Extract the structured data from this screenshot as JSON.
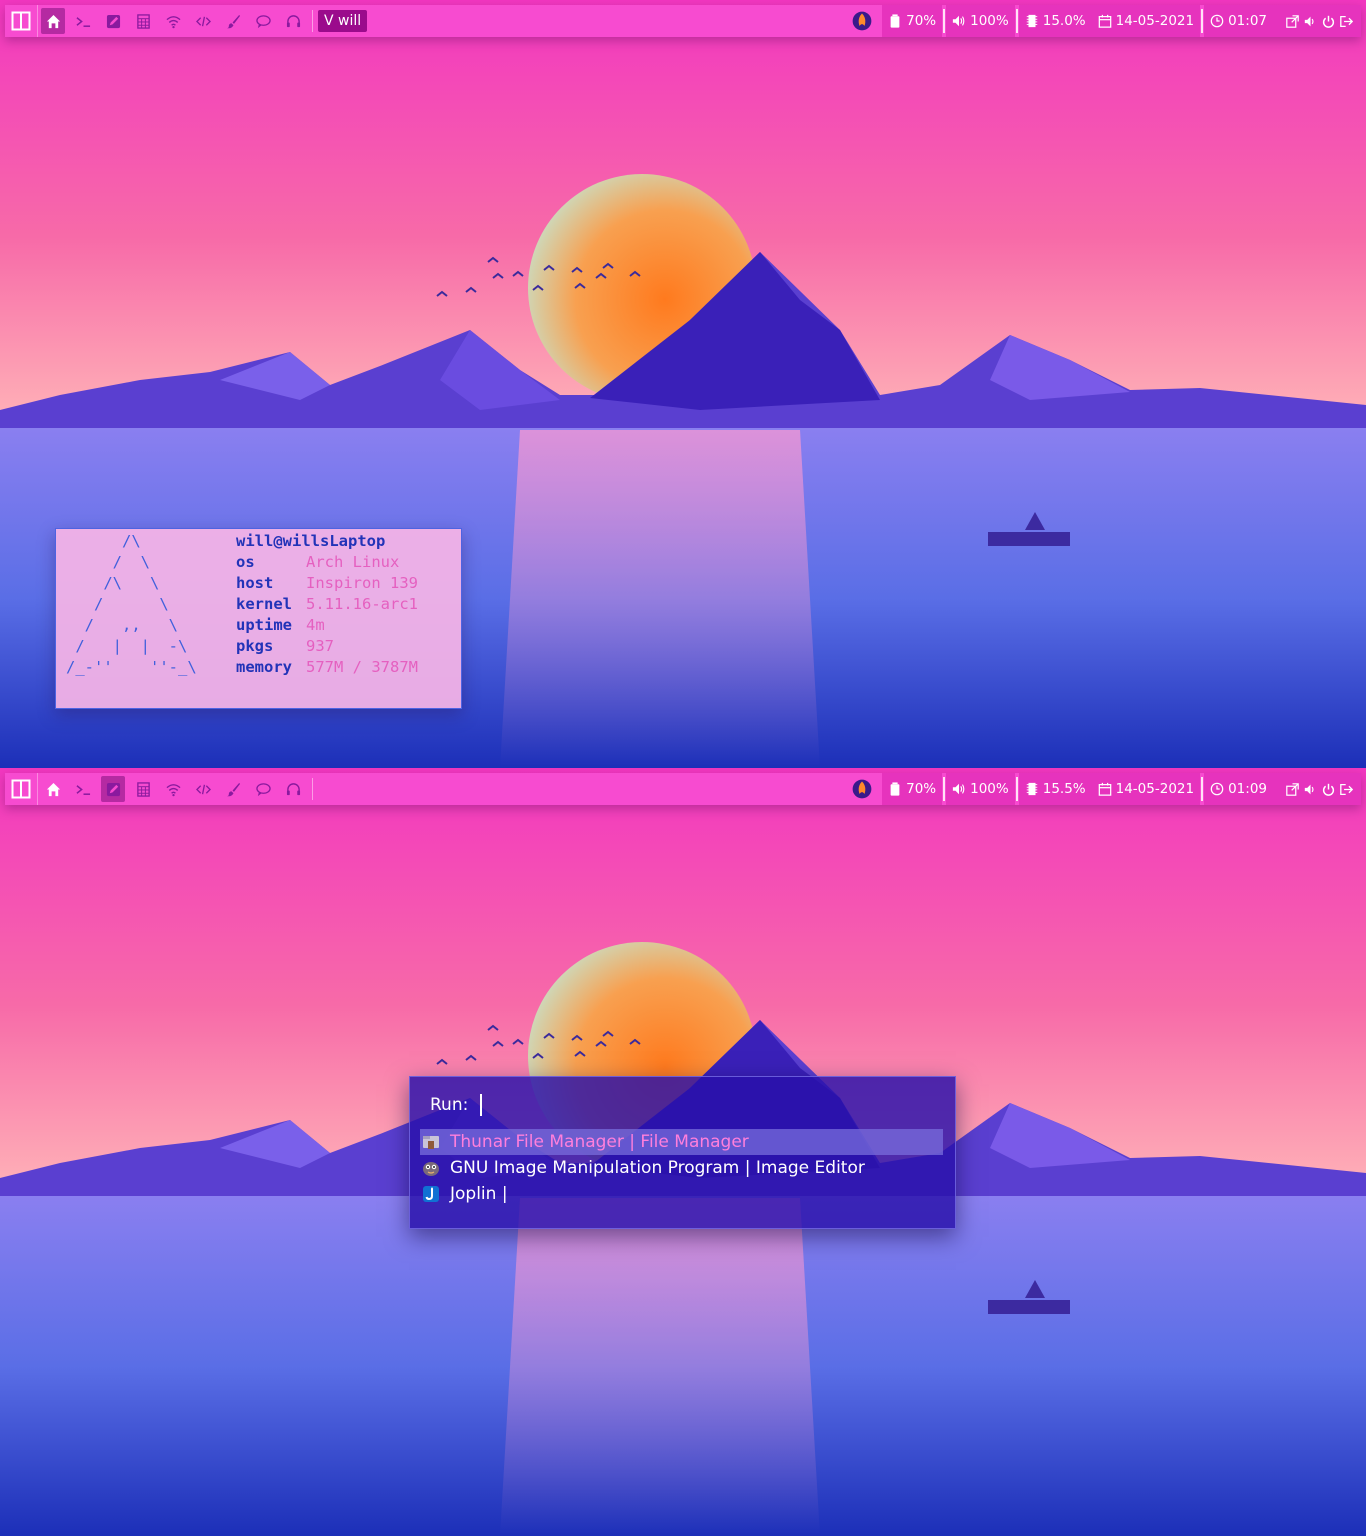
{
  "screens": {
    "top": {
      "bar": {
        "active_workspace": "home",
        "window_title": "V will",
        "battery": "70%",
        "volume": "100%",
        "cpu": "15.0%",
        "date": "14-05-2021",
        "time": "01:07"
      }
    },
    "bottom": {
      "bar": {
        "active_workspace": "edit",
        "battery": "70%",
        "volume": "100%",
        "cpu": "15.5%",
        "date": "14-05-2021",
        "time": "01:09"
      }
    }
  },
  "workspace_icons": [
    "home-icon",
    "terminal-icon",
    "edit-icon",
    "calculator-icon",
    "wifi-icon",
    "code-icon",
    "brush-icon",
    "chat-icon",
    "headphones-icon"
  ],
  "fetch": {
    "ascii": "      /\\\n     /  \\\n    /\\   \\\n   /      \\\n  /   ,,   \\\n /   |  |  -\\\n/_-''    ''-_\\",
    "user_host": "will@willsLaptop",
    "rows": [
      {
        "key": "os",
        "value": "Arch Linux"
      },
      {
        "key": "host",
        "value": "Inspiron 139"
      },
      {
        "key": "kernel",
        "value": "5.11.16-arc1"
      },
      {
        "key": "uptime",
        "value": "4m"
      },
      {
        "key": "pkgs",
        "value": "937"
      },
      {
        "key": "memory",
        "value": "577M / 3787M"
      }
    ]
  },
  "run_dialog": {
    "prompt": "Run:",
    "input_value": "",
    "items": [
      {
        "label": "Thunar File Manager | File Manager",
        "icon": "thunar-icon",
        "selected": true
      },
      {
        "label": "GNU Image Manipulation Program | Image Editor",
        "icon": "gimp-icon",
        "selected": false
      },
      {
        "label": "Joplin |",
        "icon": "joplin-icon",
        "selected": false
      }
    ]
  },
  "colors": {
    "bar": "#f74bd0",
    "bar_dark": "#e633bd",
    "workspace_active": "#b52aa2",
    "window_title_bg": "#9b0b8c",
    "fetch_bg": "#f5b4e6",
    "fetch_key": "#2233b8",
    "fetch_value": "#e560c0",
    "run_bg": "#2810aa",
    "run_selected_text": "#ff7fdc"
  }
}
